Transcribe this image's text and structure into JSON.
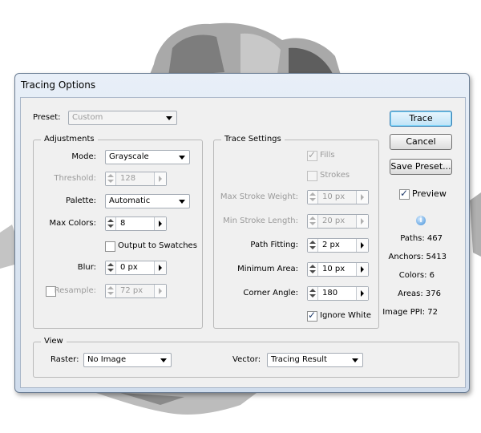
{
  "window": {
    "title": "Tracing Options"
  },
  "preset": {
    "label": "Preset:",
    "value": "Custom"
  },
  "adjustments": {
    "title": "Adjustments",
    "mode": {
      "label": "Mode:",
      "value": "Grayscale"
    },
    "threshold": {
      "label": "Threshold:",
      "value": "128"
    },
    "palette": {
      "label": "Palette:",
      "value": "Automatic"
    },
    "max_colors": {
      "label": "Max Colors:",
      "value": "8"
    },
    "output_to_swatches": {
      "label": "Output to Swatches",
      "checked": false
    },
    "blur": {
      "label": "Blur:",
      "value": "0 px"
    },
    "resample": {
      "label": "Resample:",
      "value": "72 px",
      "checked": false
    }
  },
  "trace_settings": {
    "title": "Trace Settings",
    "fills": {
      "label": "Fills",
      "checked": true
    },
    "strokes": {
      "label": "Strokes",
      "checked": false
    },
    "max_stroke_weight": {
      "label": "Max Stroke Weight:",
      "value": "10 px"
    },
    "min_stroke_length": {
      "label": "Min Stroke Length:",
      "value": "20 px"
    },
    "path_fitting": {
      "label": "Path Fitting:",
      "value": "2 px"
    },
    "minimum_area": {
      "label": "Minimum Area:",
      "value": "10 px"
    },
    "corner_angle": {
      "label": "Corner Angle:",
      "value": "180"
    },
    "ignore_white": {
      "label": "Ignore White",
      "checked": true
    }
  },
  "view": {
    "title": "View",
    "raster": {
      "label": "Raster:",
      "value": "No Image"
    },
    "vector": {
      "label": "Vector:",
      "value": "Tracing Result"
    }
  },
  "buttons": {
    "trace": "Trace",
    "cancel": "Cancel",
    "save_preset": "Save Preset..."
  },
  "preview": {
    "label": "Preview",
    "checked": true
  },
  "stats": {
    "paths": "Paths: 467",
    "anchors": "Anchors: 5413",
    "colors": "Colors: 6",
    "areas": "Areas: 376",
    "image_ppi": "Image PPI: 72"
  },
  "colors": {
    "accent_border": "#3c7fb1",
    "frame": "#cfdcec"
  },
  "icons": {
    "info": "info-icon",
    "check": "checkmark-icon"
  }
}
